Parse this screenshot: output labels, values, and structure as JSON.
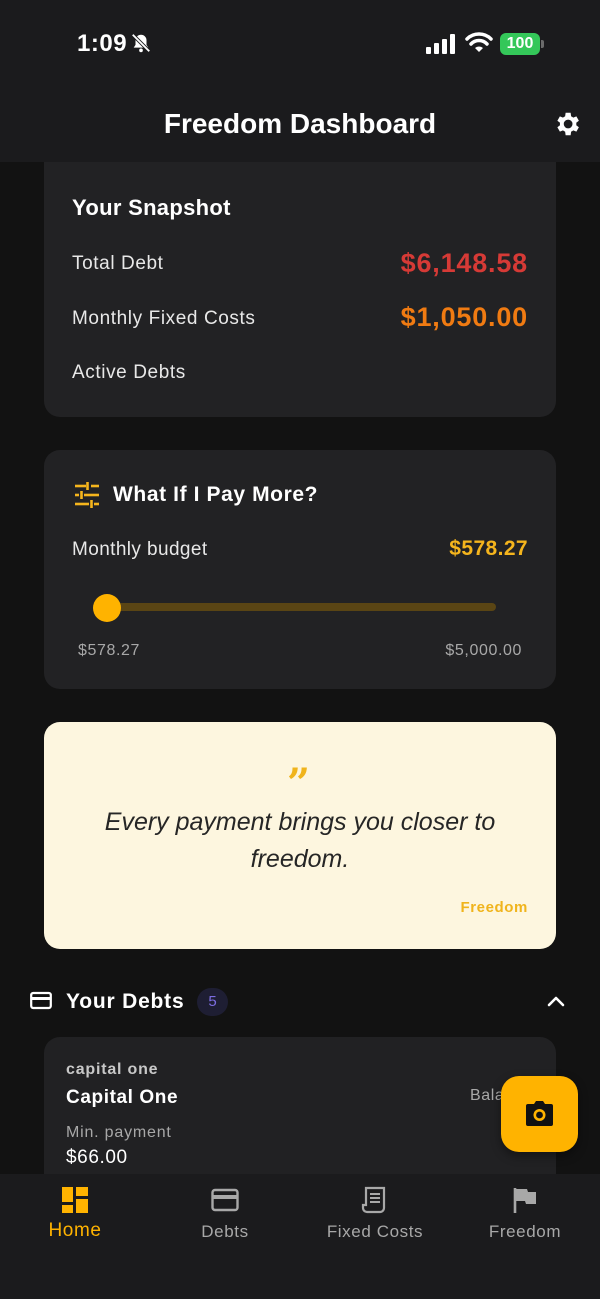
{
  "status_bar": {
    "time": "1:09",
    "battery": "100"
  },
  "header": {
    "title": "Freedom Dashboard"
  },
  "snapshot": {
    "title": "Your Snapshot",
    "rows": [
      {
        "label": "Total Debt",
        "value": "$6,148.58",
        "color": "#d63a36"
      },
      {
        "label": "Monthly Fixed Costs",
        "value": "$1,050.00",
        "color": "#f07b12"
      },
      {
        "label": "Active Debts",
        "value": ""
      }
    ]
  },
  "what_if": {
    "title": "What If I Pay More?",
    "budget_label": "Monthly budget",
    "budget_value": "$578.27",
    "slider_min": "$578.27",
    "slider_max": "$5,000.00",
    "slider_level": 0
  },
  "quote": {
    "text": "Every payment brings you closer to freedom.",
    "author": "Freedom"
  },
  "debts": {
    "title": "Your Debts",
    "count": "5",
    "items": [
      {
        "subtitle": "capital one",
        "name": "Capital One",
        "balance_label": "Bala",
        "min_label": "Min. payment",
        "min_value": "$66.00"
      }
    ]
  },
  "nav": {
    "items": [
      {
        "label": "Home",
        "icon": "dashboard-icon",
        "active": true
      },
      {
        "label": "Debts",
        "icon": "credit-card-icon",
        "active": false
      },
      {
        "label": "Fixed Costs",
        "icon": "receipt-icon",
        "active": false
      },
      {
        "label": "Freedom",
        "icon": "flag-icon",
        "active": false
      }
    ]
  },
  "colors": {
    "accent": "#ffb300",
    "background": "#121212",
    "card": "#222224",
    "quote_bg": "#fdf6df"
  }
}
